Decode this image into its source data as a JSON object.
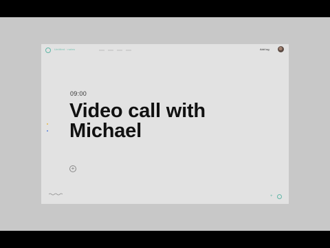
{
  "header": {
    "app_title": "Untitled · notes",
    "add_button_label": "Add log"
  },
  "event": {
    "time": "09:00",
    "title": "Video call with Michael"
  },
  "colors": {
    "accent": "#5fb6a6",
    "dot_yellow": "#e6b84a",
    "dot_blue": "#5a7fd8"
  },
  "icons": {
    "app_logo": "app-logo-icon",
    "avatar": "user-avatar",
    "add": "plus-circle-icon",
    "waveform": "waveform-icon",
    "bottom_plus": "plus-icon",
    "bottom_ring": "circle-icon"
  }
}
